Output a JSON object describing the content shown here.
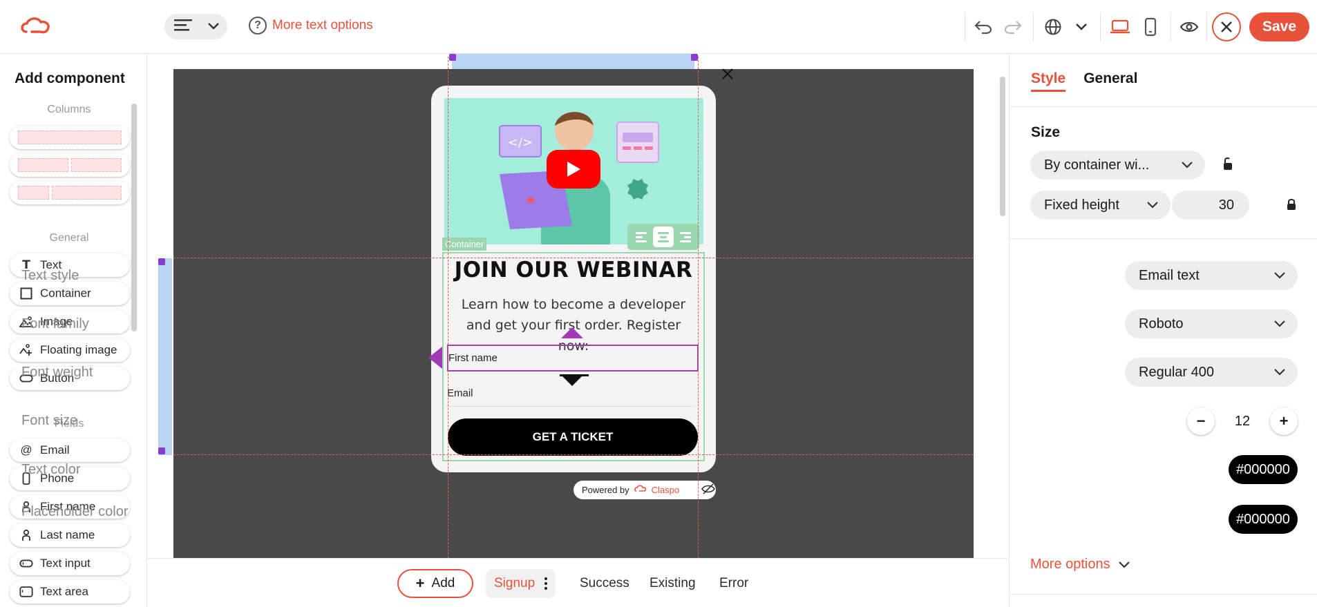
{
  "toolbar": {
    "more_text_options": "More text options",
    "save_label": "Save"
  },
  "sidebar": {
    "title": "Add component",
    "columns_label": "Columns",
    "general_label": "General",
    "fields_label": "Fields",
    "general_items": [
      {
        "label": "Text",
        "icon": "text-icon"
      },
      {
        "label": "Container",
        "icon": "container-icon"
      },
      {
        "label": "Image",
        "icon": "image-icon"
      },
      {
        "label": "Floating image",
        "icon": "floating-image-icon"
      },
      {
        "label": "Button",
        "icon": "button-icon"
      }
    ],
    "field_items": [
      {
        "label": "Email",
        "icon": "at-icon"
      },
      {
        "label": "Phone",
        "icon": "phone-icon"
      },
      {
        "label": "First name",
        "icon": "person-icon"
      },
      {
        "label": "Last name",
        "icon": "person-icon"
      },
      {
        "label": "Text input",
        "icon": "text-input-icon"
      },
      {
        "label": "Text area",
        "icon": "text-area-icon"
      }
    ]
  },
  "canvas": {
    "container_tag": "Container",
    "popup": {
      "title": "JOIN OUR WEBINAR",
      "subtitle": "Learn how to become a developer and get your first order. Register now:",
      "first_name_placeholder": "First name",
      "email_placeholder": "Email",
      "cta_label": "GET A TICKET",
      "powered_by": "Powered by",
      "brand": "Claspo"
    }
  },
  "bottom": {
    "add_label": "Add",
    "tabs": [
      "Signup",
      "Success",
      "Existing",
      "Error"
    ]
  },
  "panel": {
    "tab_style": "Style",
    "tab_general": "General",
    "size_heading": "Size",
    "width_mode": "By container wi...",
    "height_mode": "Fixed height",
    "height_value": "30",
    "text_style_label": "Text style",
    "text_style_value": "Email text",
    "font_family_label": "Font family",
    "font_family_value": "Roboto",
    "font_weight_label": "Font weight",
    "font_weight_value": "Regular 400",
    "font_size_label": "Font size",
    "font_size_value": "12",
    "text_color_label": "Text color",
    "text_color_value": "#000000",
    "placeholder_color_label": "Placeholder color",
    "placeholder_color_value": "#000000",
    "more_options": "More options"
  },
  "colors": {
    "accent": "#e8523a",
    "stage": "#494949",
    "container_outline": "#9ad7b0",
    "selection": "#a03ab8"
  }
}
